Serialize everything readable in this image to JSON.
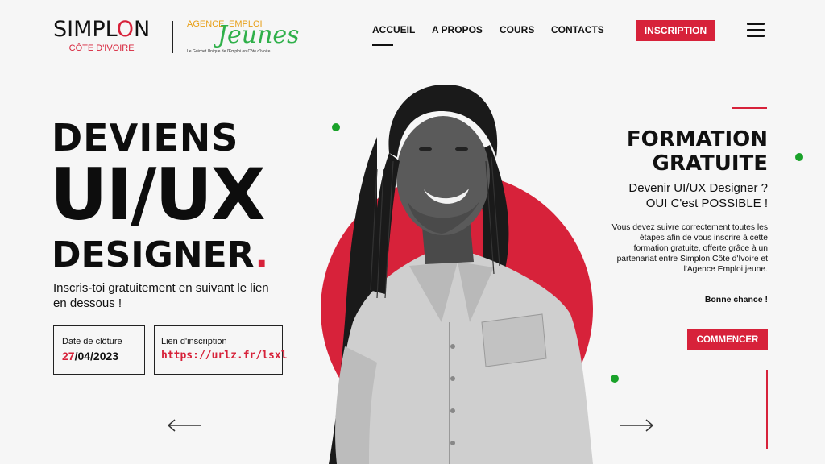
{
  "header": {
    "brand": {
      "simplon_word_a": "SIMPL",
      "simplon_o": "O",
      "simplon_word_b": "N",
      "simplon_sub": "CÔTE D'IVOIRE"
    },
    "partner": {
      "agence": "AGENCE",
      "emploi": "EMPLOI",
      "jeunes": "Jeunes",
      "tagline": "Le Guichet Unique de l'Emploi en Côte d'Ivoire"
    },
    "nav": [
      {
        "label": "ACCUEIL",
        "active": true
      },
      {
        "label": "A PROPOS",
        "active": false
      },
      {
        "label": "COURS",
        "active": false
      },
      {
        "label": "CONTACTS",
        "active": false
      }
    ],
    "cta_label": "INSCRIPTION",
    "menu_icon": "hamburger-icon"
  },
  "hero": {
    "line1": "DEVIENS",
    "line2": "UI/UX",
    "line3": "DESIGNER",
    "line3_dot": ".",
    "subtitle": "Inscris-toi gratuitement en suivant le lien en dessous !",
    "closing": {
      "label": "Date de clôture",
      "day": "27",
      "rest": "/04/2023"
    },
    "link": {
      "label": "Lien d'inscription",
      "url": "https://urlz.fr/lsxl"
    },
    "prev_icon": "arrow-left-icon",
    "next_icon": "arrow-right-icon"
  },
  "aside": {
    "title_line1": "FORMATION",
    "title_line2": "GRATUITE",
    "sub_line1": "Devenir UI/UX Designer ?",
    "sub_line2": "OUI C'est POSSIBLE !",
    "body": "Vous devez suivre correctement toutes les étapes afin de vous inscrire à cette formation gratuite, offerte grâce à un partenariat entre Simplon Côte d'Ivoire et l'Agence Emploi jeune.",
    "luck": "Bonne chance !",
    "button_label": "COMMENCER"
  },
  "colors": {
    "accent": "#d7223a",
    "green": "#1aa22a",
    "ink": "#111111",
    "background": "#f6f6f6"
  }
}
